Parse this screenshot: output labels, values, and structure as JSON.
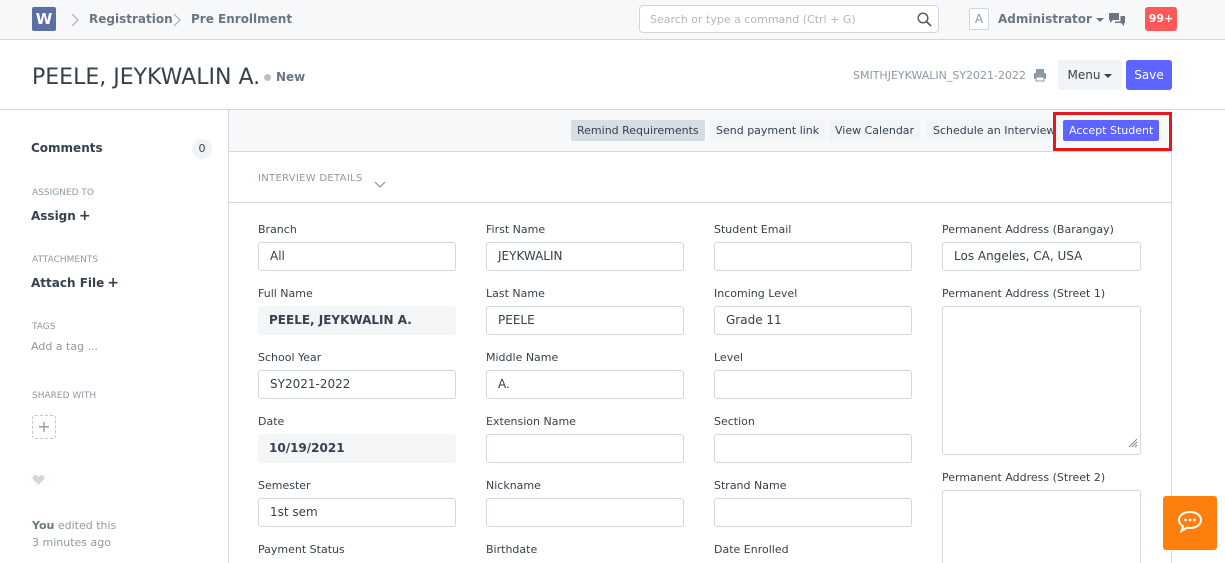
{
  "navbar": {
    "logo_letter": "W",
    "breadcrumbs": [
      "Registration",
      "Pre Enrollment"
    ],
    "search_placeholder": "Search or type a command (Ctrl + G)",
    "avatar_letter": "A",
    "user_name": "Administrator",
    "notif_count": "99+"
  },
  "header": {
    "title": "PEELE, JEYKWALIN A.",
    "status": "New",
    "doc_name": "SMITHJEYKWALIN_SY2021-2022",
    "menu_label": "Menu",
    "save_label": "Save"
  },
  "sidebar": {
    "comments_label": "Comments",
    "comments_count": "0",
    "assigned_to_label": "ASSIGNED TO",
    "assign_link": "Assign",
    "attachments_label": "ATTACHMENTS",
    "attach_link": "Attach File",
    "tags_label": "TAGS",
    "add_tag": "Add a tag ...",
    "shared_with_label": "SHARED WITH",
    "edited_by": "You",
    "edited_text": " edited this",
    "edited_time": "3 minutes ago"
  },
  "actions": {
    "remind": "Remind Requirements",
    "payment": "Send payment link",
    "calendar": "View Calendar",
    "interview": "Schedule an Interview",
    "accept": "Accept Student"
  },
  "section": {
    "title": "INTERVIEW DETAILS"
  },
  "fields": {
    "branch": {
      "label": "Branch",
      "value": "All"
    },
    "full_name": {
      "label": "Full Name",
      "value": "PEELE, JEYKWALIN A."
    },
    "school_year": {
      "label": "School Year",
      "value": "SY2021-2022"
    },
    "date": {
      "label": "Date",
      "value": "10/19/2021"
    },
    "semester": {
      "label": "Semester",
      "value": "1st sem"
    },
    "payment_status": {
      "label": "Payment Status"
    },
    "first_name": {
      "label": "First Name",
      "value": "JEYKWALIN"
    },
    "last_name": {
      "label": "Last Name",
      "value": "PEELE"
    },
    "middle_name": {
      "label": "Middle Name",
      "value": "A."
    },
    "extension_name": {
      "label": "Extension Name",
      "value": ""
    },
    "nickname": {
      "label": "Nickname",
      "value": ""
    },
    "birthdate": {
      "label": "Birthdate"
    },
    "student_email": {
      "label": "Student Email",
      "value": ""
    },
    "incoming_level": {
      "label": "Incoming Level",
      "value": "Grade 11"
    },
    "level": {
      "label": "Level",
      "value": ""
    },
    "section": {
      "label": "Section",
      "value": ""
    },
    "strand_name": {
      "label": "Strand Name",
      "value": ""
    },
    "date_enrolled": {
      "label": "Date Enrolled"
    },
    "perm_barangay": {
      "label": "Permanent Address (Barangay)",
      "value": "Los Angeles, CA, USA"
    },
    "perm_street1": {
      "label": "Permanent Address (Street 1)"
    },
    "perm_street2": {
      "label": "Permanent Address (Street 2)"
    }
  },
  "colors": {
    "primary": "#5e64ff",
    "highlight": "#e0181f",
    "notif": "#ff5858",
    "chat": "#ff7f0e"
  }
}
